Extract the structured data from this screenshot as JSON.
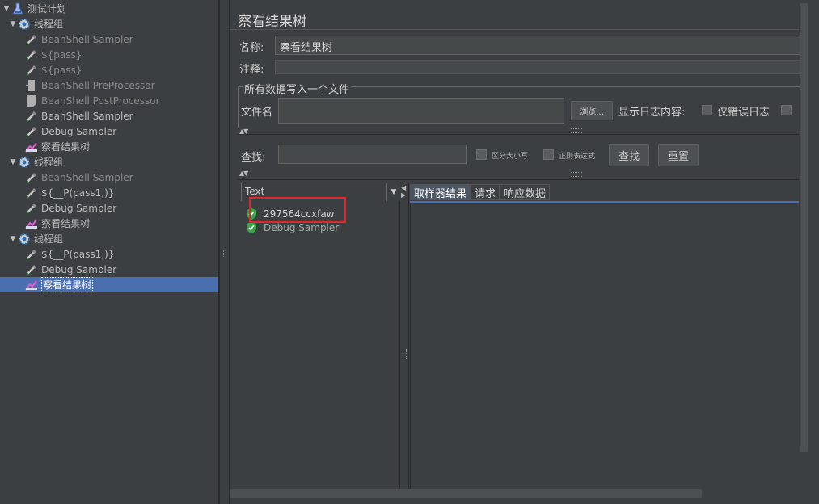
{
  "tree": {
    "items": [
      {
        "label": "测试计划",
        "icon": "flask-icon",
        "depth": 0,
        "toggle": "▼",
        "dim": false,
        "selected": false
      },
      {
        "label": "线程组",
        "icon": "gear-icon",
        "depth": 1,
        "toggle": "▼",
        "dim": false,
        "selected": false
      },
      {
        "label": "BeanShell Sampler",
        "icon": "pipette-icon",
        "depth": 2,
        "toggle": "",
        "dim": true,
        "selected": false
      },
      {
        "label": "${pass}",
        "icon": "pipette-icon",
        "depth": 2,
        "toggle": "",
        "dim": true,
        "selected": false
      },
      {
        "label": "${pass}",
        "icon": "pipette-icon",
        "depth": 2,
        "toggle": "",
        "dim": true,
        "selected": false
      },
      {
        "label": "BeanShell PreProcessor",
        "icon": "preprocessor-icon",
        "depth": 2,
        "toggle": "",
        "dim": true,
        "selected": false
      },
      {
        "label": "BeanShell PostProcessor",
        "icon": "postprocessor-icon",
        "depth": 2,
        "toggle": "",
        "dim": true,
        "selected": false
      },
      {
        "label": "BeanShell Sampler",
        "icon": "pipette-icon",
        "depth": 2,
        "toggle": "",
        "dim": false,
        "selected": false
      },
      {
        "label": "Debug Sampler",
        "icon": "pipette-icon",
        "depth": 2,
        "toggle": "",
        "dim": false,
        "selected": false
      },
      {
        "label": "察看结果树",
        "icon": "chart-icon",
        "depth": 2,
        "toggle": "",
        "dim": false,
        "selected": false
      },
      {
        "label": "线程组",
        "icon": "gear-icon",
        "depth": 1,
        "toggle": "▼",
        "dim": false,
        "selected": false
      },
      {
        "label": "BeanShell Sampler",
        "icon": "pipette-icon",
        "depth": 2,
        "toggle": "",
        "dim": true,
        "selected": false
      },
      {
        "label": "${__P(pass1,)}",
        "icon": "pipette-icon",
        "depth": 2,
        "toggle": "",
        "dim": false,
        "selected": false
      },
      {
        "label": "Debug Sampler",
        "icon": "pipette-icon",
        "depth": 2,
        "toggle": "",
        "dim": false,
        "selected": false
      },
      {
        "label": "察看结果树",
        "icon": "chart-icon",
        "depth": 2,
        "toggle": "",
        "dim": false,
        "selected": false
      },
      {
        "label": "线程组",
        "icon": "gear-icon",
        "depth": 1,
        "toggle": "▼",
        "dim": false,
        "selected": false
      },
      {
        "label": "${__P(pass1,)}",
        "icon": "pipette-icon",
        "depth": 2,
        "toggle": "",
        "dim": false,
        "selected": false
      },
      {
        "label": "Debug Sampler",
        "icon": "pipette-icon",
        "depth": 2,
        "toggle": "",
        "dim": false,
        "selected": false
      },
      {
        "label": "察看结果树",
        "icon": "chart-icon",
        "depth": 2,
        "toggle": "",
        "dim": false,
        "selected": true
      }
    ]
  },
  "panel": {
    "title": "察看结果树",
    "name_label": "名称:",
    "name_value": "察看结果树",
    "comment_label": "注释:",
    "comment_value": "",
    "file_group_title": "所有数据写入一个文件",
    "filename_label": "文件名",
    "filename_value": "",
    "browse_button": "浏览...",
    "log_content_label": "显示日志内容:",
    "errors_only_label": "仅错误日志",
    "search_label": "查找:",
    "search_value": "",
    "case_sensitive_label": "区分大小写",
    "regex_label": "正则表达式",
    "find_button": "查找",
    "reset_button": "重置",
    "renderer_select": "Text",
    "results": [
      "297564ccxfaw",
      "Debug Sampler"
    ],
    "tabs": [
      "取样器结果",
      "请求",
      "响应数据"
    ]
  },
  "colors": {
    "background": "#3c3f41",
    "selection": "#4b6eaf",
    "success": "#3aa34a",
    "highlight_box": "#e0262d"
  }
}
